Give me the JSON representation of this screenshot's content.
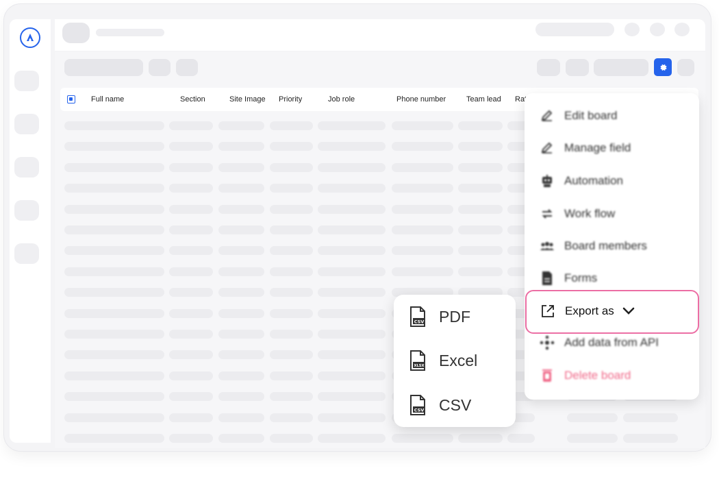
{
  "table": {
    "columns": [
      "Full name",
      "Section",
      "Site Image",
      "Priority",
      "Job role",
      "Phone number",
      "Team lead",
      "Rat"
    ]
  },
  "menu": {
    "items": [
      {
        "label": "Edit board",
        "icon": "pencil-icon"
      },
      {
        "label": "Manage field",
        "icon": "pencil-icon"
      },
      {
        "label": "Automation",
        "icon": "robot-icon"
      },
      {
        "label": "Work flow",
        "icon": "arrows-icon"
      },
      {
        "label": "Board members",
        "icon": "users-icon"
      },
      {
        "label": "Forms",
        "icon": "document-icon"
      }
    ],
    "export": {
      "label": "Export as",
      "icon": "export-icon"
    },
    "after": [
      {
        "label": "Add data from API",
        "icon": "api-icon"
      },
      {
        "label": "Delete board",
        "icon": "trash-icon"
      }
    ]
  },
  "export_submenu": {
    "items": [
      {
        "label": "PDF",
        "icon_tag": "CSV"
      },
      {
        "label": "Excel",
        "icon_tag": "XLSX"
      },
      {
        "label": "CSV",
        "icon_tag": "CSV"
      }
    ]
  },
  "colors": {
    "accent": "#2563eb",
    "highlight": "#ec6ea4",
    "danger": "#f06a8a"
  }
}
